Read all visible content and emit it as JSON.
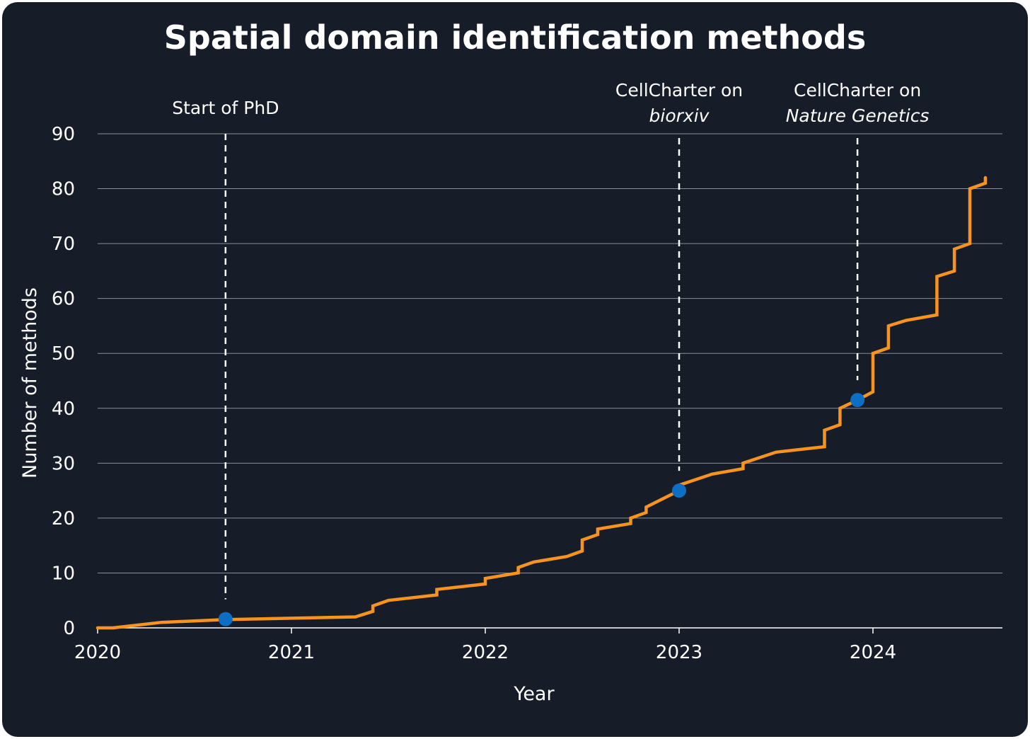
{
  "chart_data": {
    "type": "line",
    "title": "Spatial domain identification methods",
    "xlabel": "Year",
    "ylabel": "Number of methods",
    "xlim": [
      2020,
      2024.67
    ],
    "ylim": [
      0,
      90
    ],
    "x_ticks": [
      2020,
      2021,
      2022,
      2023,
      2024
    ],
    "y_ticks": [
      0,
      10,
      20,
      30,
      40,
      50,
      60,
      70,
      80,
      90
    ],
    "grid": "horizontal",
    "colors": {
      "background": "#161c28",
      "line": "#f7931e",
      "marker": "#0c6fc4",
      "grid": "#8a8f99",
      "text": "#ffffff"
    },
    "series": [
      {
        "step": true,
        "points": [
          [
            2020.0,
            0
          ],
          [
            2020.08,
            0
          ],
          [
            2020.33,
            1
          ],
          [
            2020.65,
            1.5
          ],
          [
            2021.33,
            2
          ],
          [
            2021.42,
            3
          ],
          [
            2021.42,
            4
          ],
          [
            2021.5,
            5
          ],
          [
            2021.75,
            6
          ],
          [
            2021.75,
            7
          ],
          [
            2022.0,
            8
          ],
          [
            2022.0,
            9
          ],
          [
            2022.17,
            10
          ],
          [
            2022.17,
            11
          ],
          [
            2022.25,
            12
          ],
          [
            2022.42,
            13
          ],
          [
            2022.5,
            14
          ],
          [
            2022.5,
            16
          ],
          [
            2022.58,
            17
          ],
          [
            2022.58,
            18
          ],
          [
            2022.75,
            19
          ],
          [
            2022.75,
            20
          ],
          [
            2022.83,
            21
          ],
          [
            2022.83,
            22
          ],
          [
            2023.0,
            25
          ],
          [
            2023.0,
            26
          ],
          [
            2023.17,
            28
          ],
          [
            2023.33,
            29
          ],
          [
            2023.33,
            30
          ],
          [
            2023.5,
            32
          ],
          [
            2023.75,
            33
          ],
          [
            2023.75,
            36
          ],
          [
            2023.83,
            37
          ],
          [
            2023.83,
            40
          ],
          [
            2023.92,
            41.5
          ],
          [
            2024.0,
            43
          ],
          [
            2024.0,
            50
          ],
          [
            2024.08,
            51
          ],
          [
            2024.08,
            55
          ],
          [
            2024.17,
            56
          ],
          [
            2024.33,
            57
          ],
          [
            2024.33,
            64
          ],
          [
            2024.42,
            65
          ],
          [
            2024.42,
            69
          ],
          [
            2024.5,
            70
          ],
          [
            2024.5,
            80
          ],
          [
            2024.58,
            81
          ],
          [
            2024.58,
            82
          ]
        ]
      }
    ],
    "annotations": [
      {
        "x": 2020.66,
        "y": 1.6,
        "lines": [
          {
            "text": "Start of PhD",
            "italic": false
          }
        ]
      },
      {
        "x": 2023.0,
        "y": 25,
        "lines": [
          {
            "text": "CellCharter on",
            "italic": false
          },
          {
            "text": "biorxiv",
            "italic": true
          }
        ]
      },
      {
        "x": 2023.92,
        "y": 41.5,
        "lines": [
          {
            "text": "CellCharter on",
            "italic": false
          },
          {
            "text": "Nature Genetics",
            "italic": true
          }
        ]
      }
    ]
  }
}
